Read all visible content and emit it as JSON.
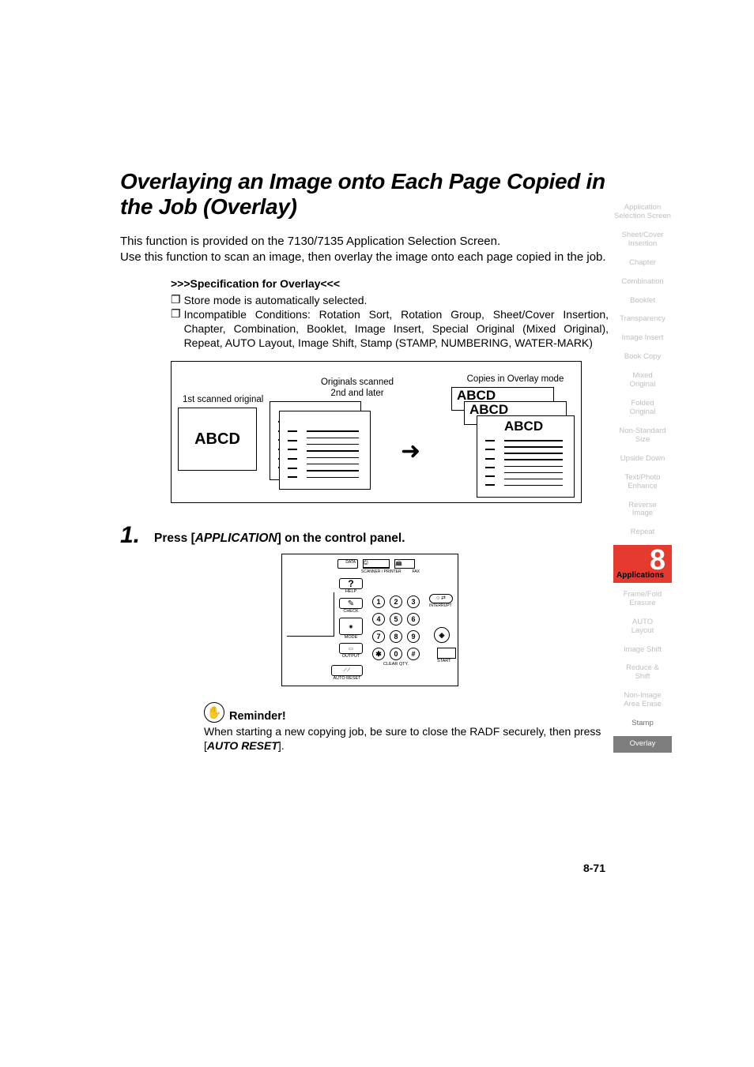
{
  "title": "Overlaying an Image onto Each Page Copied in the Job (Overlay)",
  "intro": "This function is provided on the 7130/7135 Application Selection Screen.\nUse this function to scan an image, then overlay the image onto each page copied in the job.",
  "spec": {
    "heading": ">>>Specification for Overlay<<<",
    "item1": "Store mode is automatically selected.",
    "item2": "Incompatible Conditions: Rotation Sort, Rotation Group, Sheet/Cover Insertion, Chapter, Combination, Booklet, Image Insert, Special Original (Mixed Original), Repeat, AUTO Layout, Image Shift, Stamp (STAMP, NUMBERING, WATER-MARK)"
  },
  "diagram": {
    "label_1st": "1st scanned original",
    "label_scanned": "Originals scanned\n2nd and later",
    "label_copies": "Copies in Overlay mode",
    "abcd": "ABCD",
    "arrow": "➜"
  },
  "step1": {
    "num": "1.",
    "prefix": "Press [",
    "app": "APPLICATION",
    "suffix": "] on the control panel."
  },
  "panel": {
    "data": "DATA",
    "scanner": "SCANNER / PRINTER",
    "fax": "FAX",
    "help": "HELP",
    "check": "CHECK",
    "mode": "MODE",
    "output": "OUTPUT",
    "autoreset": "AUTO RESET",
    "interrupt": "INTERRUPT",
    "clearqty": "CLEAR QTY.",
    "start": "START",
    "k1": "1",
    "k2": "2",
    "k3": "3",
    "k4": "4",
    "k5": "5",
    "k6": "6",
    "k7": "7",
    "k8": "8",
    "k9": "9",
    "k0": "0",
    "kstar": "✱",
    "khash": "#"
  },
  "reminder": {
    "title": "Reminder!",
    "body_prefix": "When starting a new copying job, be sure to close the RADF securely, then press [",
    "autoreset": "AUTO RESET",
    "body_suffix": "]."
  },
  "pagenum": "8-71",
  "nav": {
    "items_top": [
      "Application\nSelection Screen",
      "Sheet/Cover\nInsertion",
      "Chapter",
      "Combination",
      "Booklet",
      "Transparency",
      "Image Insert",
      "Book Copy",
      "Mixed\nOriginal",
      "Folded\nOriginal",
      "Non-Standard\nSize",
      "Upside Down",
      "Text/Photo\nEnhance",
      "Reverse\nImage",
      "Repeat"
    ],
    "chapter_num": "8",
    "chapter_label": "Applications",
    "items_bottom": [
      "Frame/Fold\nErasure",
      "AUTO\nLayout",
      "Image Shift",
      "Reduce &\nShift",
      "Non-Image\nArea Erase",
      "Stamp"
    ],
    "overlay": "Overlay"
  }
}
